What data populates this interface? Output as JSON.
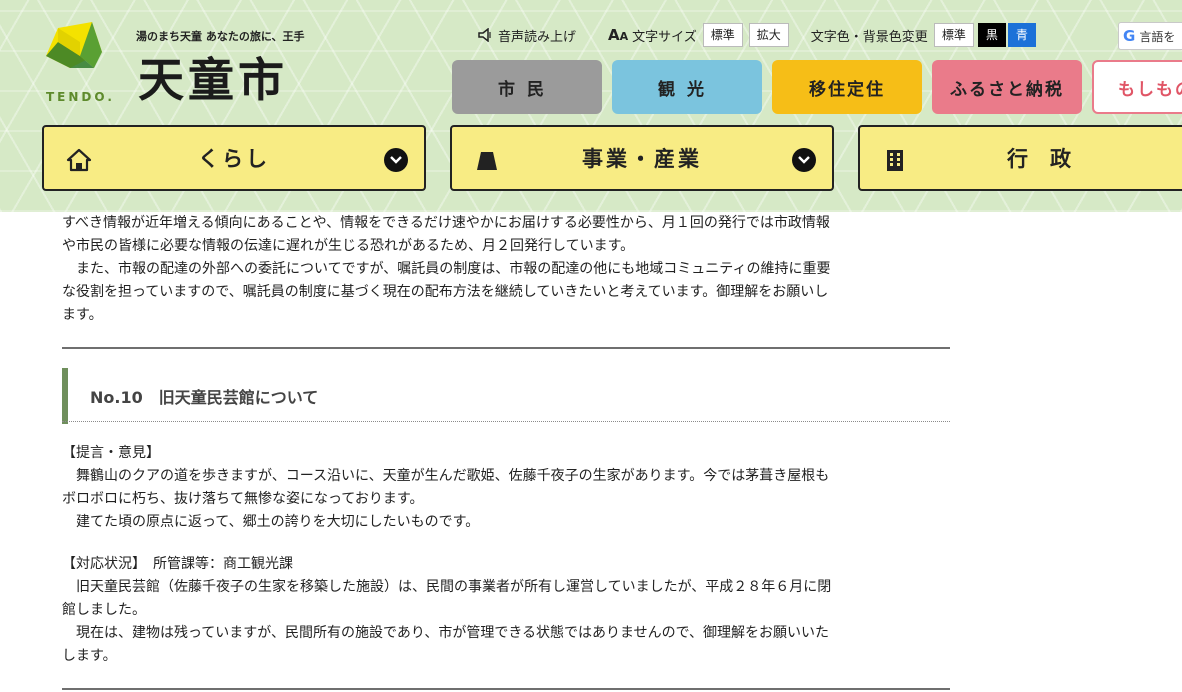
{
  "site": {
    "tagline": "湯のまち天童 あなたの旅に、王手",
    "name": "天童市",
    "logo_text": "TENDO."
  },
  "tools": {
    "read_aloud": "音声読み上げ",
    "font_size_label": "文字サイズ",
    "font_standard": "標準",
    "font_large": "拡大",
    "color_label": "文字色・背景色変更",
    "color_standard": "標準",
    "color_black": "黒",
    "color_blue": "青",
    "translate": "言語を"
  },
  "audience_nav": [
    "市民",
    "観光",
    "移住定住",
    "ふるさと納税",
    "もしもの"
  ],
  "main_nav": [
    "くらし",
    "事業・産業",
    "行政"
  ],
  "content": {
    "intro_lines": [
      "すべき情報が近年増える傾向にあることや、情報をできるだけ速やかにお届けする必要性から、月１回の発行では市政情報",
      "や市民の皆様に必要な情報の伝達に遅れが生じる恐れがあるため、月２回発行しています。",
      "　また、市報の配達の外部への委託についてですが、嘱託員の制度は、市報の配達の他にも地域コミュニティの維持に重要",
      "な役割を担っていますので、嘱託員の制度に基づく現在の配布方法を継続していきたいと考えています。御理解をお願いし",
      "ます。"
    ],
    "section_title": "No.10　旧天童民芸館について",
    "proposal_heading": "【提言・意見】",
    "proposal_lines": [
      "　舞鶴山のクアの道を歩きますが、コース沿いに、天童が生んだ歌姫、佐藤千夜子の生家があります。今では茅葺き屋根も",
      "ボロボロに朽ち、抜け落ちて無惨な姿になっております。",
      "　建てた頃の原点に返って、郷土の誇りを大切にしたいものです。"
    ],
    "response_heading": "【対応状況】　所管課等：商工観光課",
    "response_lines": [
      "　旧天童民芸館（佐藤千夜子の生家を移築した施設）は、民間の事業者が所有し運営していましたが、平成２８年６月に閉",
      "館しました。",
      "　現在は、建物は残っていますが、民間所有の施設であり、市が管理できる状態ではありませんので、御理解をお願いいた",
      "します。"
    ]
  },
  "colors": {
    "header_bg": "#d6e9c6",
    "nav_yellow": "#f8ec84",
    "citizen": "#9b9b9b",
    "tourism": "#7bc4de",
    "migrate": "#f6be17",
    "furusato": "#ea7b8a",
    "heading_accent": "#6f8f5c"
  }
}
